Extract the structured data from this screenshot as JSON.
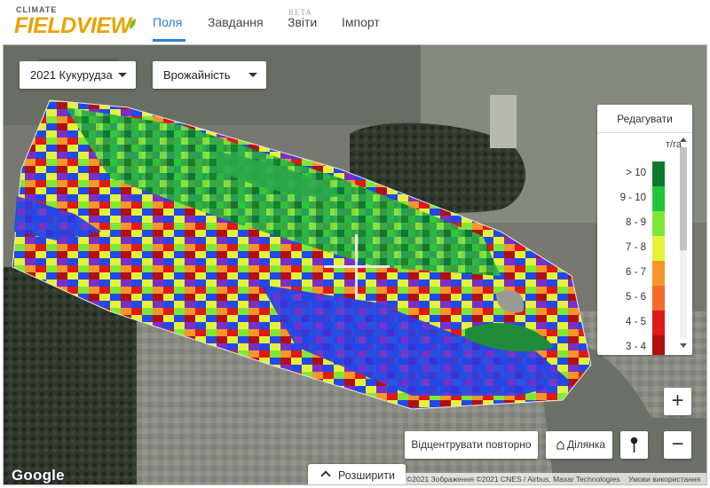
{
  "header": {
    "logo_small": "CLIMATE",
    "logo_big": "FIELDVIEW",
    "nav": [
      {
        "label": "Поля",
        "active": true
      },
      {
        "label": "Завдання",
        "active": false
      },
      {
        "label": "Звіти",
        "active": false,
        "badge": "BETA"
      },
      {
        "label": "Імпорт",
        "active": false
      }
    ],
    "accent_color": "#2a7fd4",
    "logo_color": "#e9a400"
  },
  "map": {
    "season_select": "2021 Кукурудза",
    "layer_select": "Врожайність",
    "legend": {
      "edit_label": "Редагувати",
      "unit": "т/га",
      "ranges": [
        {
          "label": "> 10",
          "color": "#0c7a2b"
        },
        {
          "label": "9 - 10",
          "color": "#22c43a"
        },
        {
          "label": "8 - 9",
          "color": "#7ee83a"
        },
        {
          "label": "7 - 8",
          "color": "#e6f23a"
        },
        {
          "label": "6 - 7",
          "color": "#f5962a"
        },
        {
          "label": "5 - 6",
          "color": "#f56a2a"
        },
        {
          "label": "4 - 5",
          "color": "#e01818"
        },
        {
          "label": "3 - 4",
          "color": "#b01010"
        }
      ]
    },
    "buttons": {
      "recenter": "Відцентрувати повторно",
      "area": "Ділянка",
      "zoom_in": "+",
      "zoom_out": "−"
    },
    "expand_label": "Розширити",
    "google_label": "Google",
    "attribution": "©2021 Зображення ©2021 CNES / Airbus, Maxar Technologies",
    "terms": "Умови використання"
  }
}
